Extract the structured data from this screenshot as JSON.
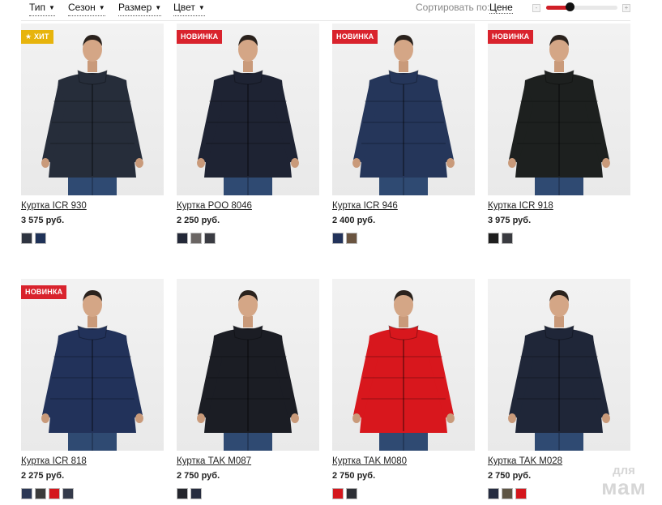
{
  "filters": [
    {
      "label": "Тип"
    },
    {
      "label": "Сезон"
    },
    {
      "label": "Размер"
    },
    {
      "label": "Цвет"
    }
  ],
  "sort": {
    "label": "Сортировать по:",
    "value": "Цене"
  },
  "zoom": {
    "level": 0.33,
    "minus": "-",
    "plus": "+"
  },
  "colors": {
    "accent": "#d9232d",
    "hit": "#e7b40c"
  },
  "products": [
    {
      "title": "Куртка ICR 930",
      "price": "3 575 руб.",
      "badge": "★ ХИТ",
      "badge_type": "hit",
      "jacket_color": "#262d3a",
      "swatches": [
        "#2e3440",
        "#1f3258"
      ]
    },
    {
      "title": "Куртка POO 8046",
      "price": "2 250 руб.",
      "badge": "НОВИНКА",
      "badge_type": "new",
      "jacket_color": "#1e2333",
      "swatches": [
        "#232838",
        "#6a6563",
        "#3a3b42"
      ]
    },
    {
      "title": "Куртка ICR 946",
      "price": "2 400 руб.",
      "badge": "НОВИНКА",
      "badge_type": "new",
      "jacket_color": "#25365a",
      "swatches": [
        "#22325a",
        "#6a5440"
      ]
    },
    {
      "title": "Куртка ICR 918",
      "price": "3 975 руб.",
      "badge": "НОВИНКА",
      "badge_type": "new",
      "jacket_color": "#1d201f",
      "swatches": [
        "#1e1e1e",
        "#3a3b40"
      ]
    },
    {
      "title": "Куртка ICR 818",
      "price": "2 275 руб.",
      "badge": "НОВИНКА",
      "badge_type": "new",
      "jacket_color": "#22325a",
      "swatches": [
        "#2b3754",
        "#3b3b3b",
        "#d4161c",
        "#343a4a"
      ]
    },
    {
      "title": "Куртка TAK M087",
      "price": "2 750 руб.",
      "badge": "",
      "badge_type": "",
      "jacket_color": "#1b1d24",
      "swatches": [
        "#23252c",
        "#262c3e"
      ]
    },
    {
      "title": "Куртка TAK M080",
      "price": "2 750 руб.",
      "badge": "",
      "badge_type": "",
      "jacket_color": "#d8171d",
      "swatches": [
        "#d4161c",
        "#2d2f35"
      ]
    },
    {
      "title": "Куртка TAK M028",
      "price": "2 750 руб.",
      "badge": "",
      "badge_type": "",
      "jacket_color": "#1f2638",
      "swatches": [
        "#252c40",
        "#5e5544",
        "#d4161c"
      ]
    }
  ],
  "watermark": {
    "top": "для",
    "bottom": "мам"
  }
}
